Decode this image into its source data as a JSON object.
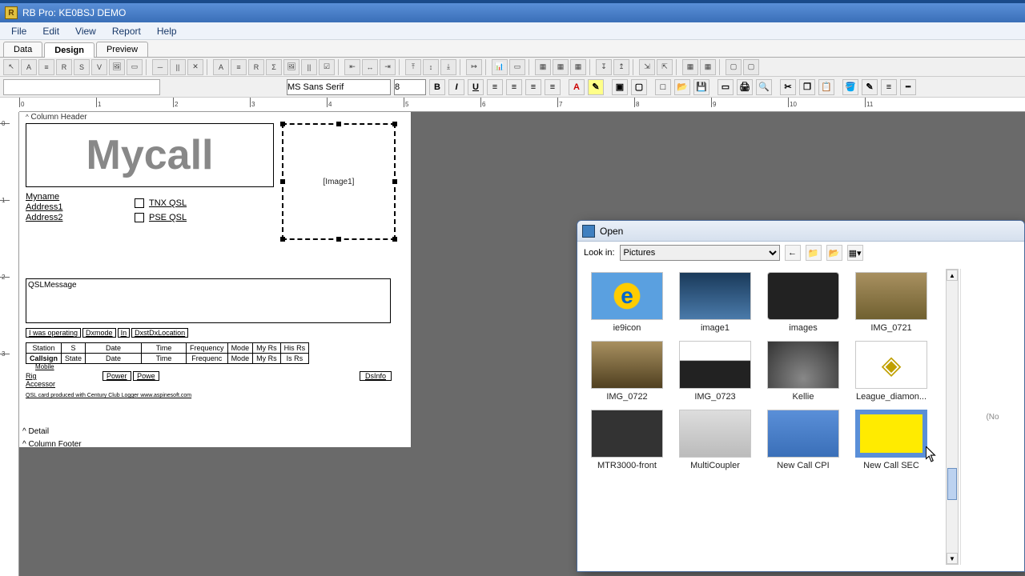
{
  "title_bar": {
    "text": "RB Pro: KE0BSJ DEMO",
    "icon_letter": "R"
  },
  "menus": [
    "File",
    "Edit",
    "View",
    "Report",
    "Help"
  ],
  "tabs": [
    "Data",
    "Design",
    "Preview"
  ],
  "active_tab": 1,
  "font_field": {
    "name": "MS Sans Serif",
    "size": "8"
  },
  "formatting": {
    "bold": "B",
    "italic": "I",
    "underline": "U"
  },
  "object_field": "",
  "bands": {
    "column_header": "Column Header",
    "detail": "Detail",
    "column_footer": "Column Footer"
  },
  "design": {
    "mycall": "Mycall",
    "image_placeholder": "[Image1]",
    "name_fields": [
      "Myname",
      "Address1",
      "Address2"
    ],
    "checks": [
      "TNX QSL",
      "PSE QSL"
    ],
    "msg_label": "QSLMessage",
    "operating_row": [
      "I was operating",
      "Dxmode",
      "In",
      "DxstDxLocation"
    ],
    "table_headers": [
      "Station",
      "S",
      "Date",
      "Time",
      "Frequency",
      "Mode",
      "My Rs",
      "His Rs"
    ],
    "table_row2": [
      "Callsign",
      "State",
      "Date",
      "Time",
      "Frequenc",
      "Mode",
      "My Rs",
      "Is Rs"
    ],
    "mobile": "Mobile",
    "rig": "Rig",
    "accessor": "Accessor",
    "power": [
      "Power",
      "Powe"
    ],
    "footer_text": "QSL card produced with Century Club Logger  www.aspinesoft.com",
    "dsinfo": "DsInfo"
  },
  "open_dialog": {
    "title": "Open",
    "lookin_label": "Look in:",
    "lookin_value": "Pictures",
    "preview_text": "(No",
    "files": [
      {
        "name": "ie9icon",
        "hint": "e"
      },
      {
        "name": "image1",
        "hint": "city"
      },
      {
        "name": "images",
        "hint": "box"
      },
      {
        "name": "IMG_0721",
        "hint": "road"
      },
      {
        "name": "IMG_0722",
        "hint": "road"
      },
      {
        "name": "IMG_0723",
        "hint": "car"
      },
      {
        "name": "Kellie",
        "hint": "dash"
      },
      {
        "name": "League_diamon...",
        "hint": "⬧"
      },
      {
        "name": "MTR3000-front",
        "hint": "radio"
      },
      {
        "name": "MultiCoupler",
        "hint": "unit"
      },
      {
        "name": "New Call CPI",
        "hint": "win"
      },
      {
        "name": "New Call SEC",
        "hint": "win"
      }
    ]
  },
  "ruler_numbers": [
    "0",
    "1",
    "2",
    "3",
    "4",
    "5",
    "6",
    "7",
    "8",
    "9",
    "10",
    "11"
  ],
  "vruler_numbers": [
    "0",
    "1",
    "2",
    "3"
  ]
}
